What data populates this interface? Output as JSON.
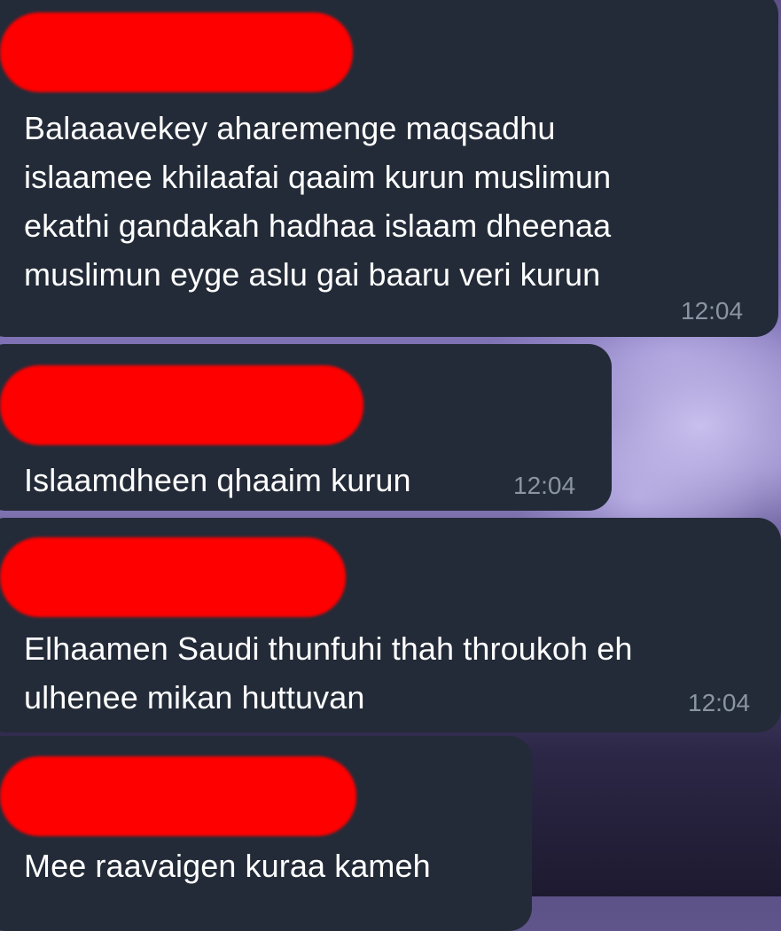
{
  "messages": [
    {
      "lines": [
        "Balaaavekey aharemenge maqsadhu",
        "islaamee khilaafai qaaim kurun muslimun",
        "ekathi gandakah hadhaa islaam dheenaa",
        "muslimun eyge aslu gai baaru veri kurun"
      ],
      "time": "12:04"
    },
    {
      "lines": [
        "Islaamdheen qhaaim kurun"
      ],
      "time": "12:04"
    },
    {
      "lines": [
        "Elhaamen Saudi thunfuhi thah throukoh eh",
        "ulhenee mikan huttuvan"
      ],
      "time": "12:04"
    },
    {
      "lines": [
        "Mee raavaigen kuraa kameh"
      ],
      "time": ""
    }
  ],
  "colors": {
    "bubble": "#232b38",
    "text": "#ffffff",
    "timestamp": "#8b94a3",
    "redaction": "#ff0000"
  }
}
